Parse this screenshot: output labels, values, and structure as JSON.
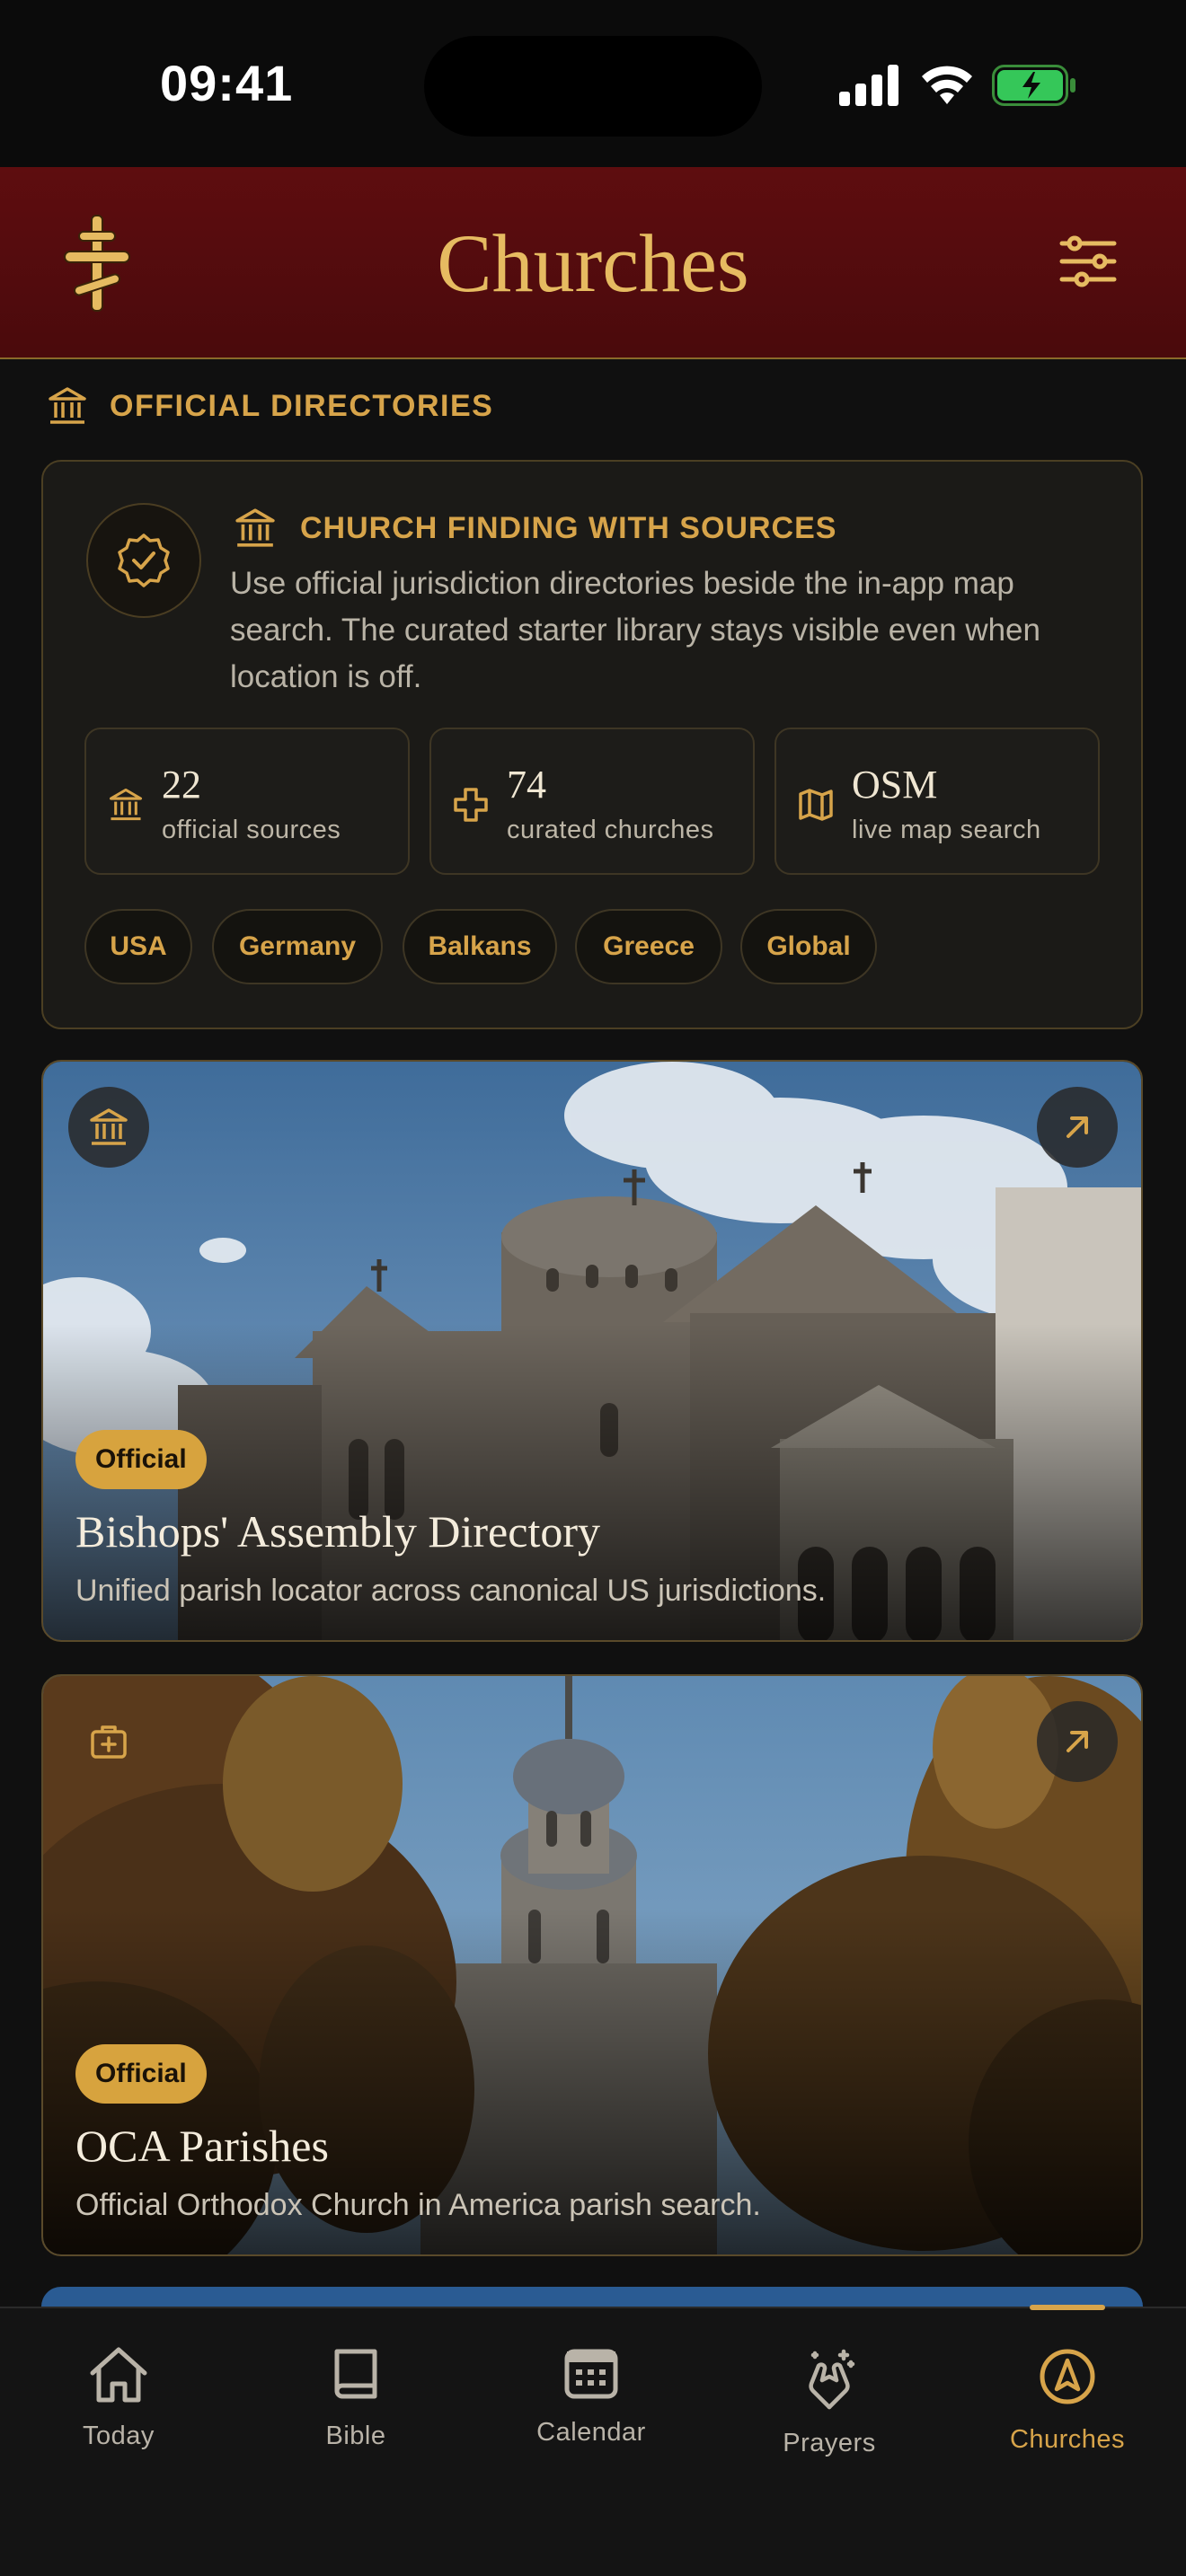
{
  "status": {
    "time": "09:41"
  },
  "header": {
    "title": "Churches"
  },
  "section": {
    "label": "OFFICIAL DIRECTORIES"
  },
  "info": {
    "heading": "CHURCH FINDING WITH SOURCES",
    "description": "Use official jurisdiction directories beside the in-app map search. The curated starter library stays visible even when location is off.",
    "stats": [
      {
        "value": "22",
        "label": "official sources",
        "icon": "institution-icon"
      },
      {
        "value": "74",
        "label": "curated churches",
        "icon": "cross-icon"
      },
      {
        "value": "OSM",
        "label": "live map search",
        "icon": "map-icon"
      }
    ],
    "regions": [
      "USA",
      "Germany",
      "Balkans",
      "Greece",
      "Global"
    ]
  },
  "directories": [
    {
      "badge": "Official",
      "title": "Bishops' Assembly Directory",
      "subtitle": "Unified parish locator across canonical US jurisdictions.",
      "icon": "institution-icon"
    },
    {
      "badge": "Official",
      "title": "OCA Parishes",
      "subtitle": "Official Orthodox Church in America parish search.",
      "icon": "medical-briefcase-icon"
    }
  ],
  "tabs": [
    {
      "label": "Today",
      "icon": "home-icon"
    },
    {
      "label": "Bible",
      "icon": "book-icon"
    },
    {
      "label": "Calendar",
      "icon": "calendar-icon"
    },
    {
      "label": "Prayers",
      "icon": "praying-hands-icon"
    },
    {
      "label": "Churches",
      "icon": "compass-icon"
    }
  ],
  "colors": {
    "accent": "#d7a44a",
    "header_bg": "#5e0d0f",
    "background": "#101010",
    "badge": "#d7a33e"
  }
}
